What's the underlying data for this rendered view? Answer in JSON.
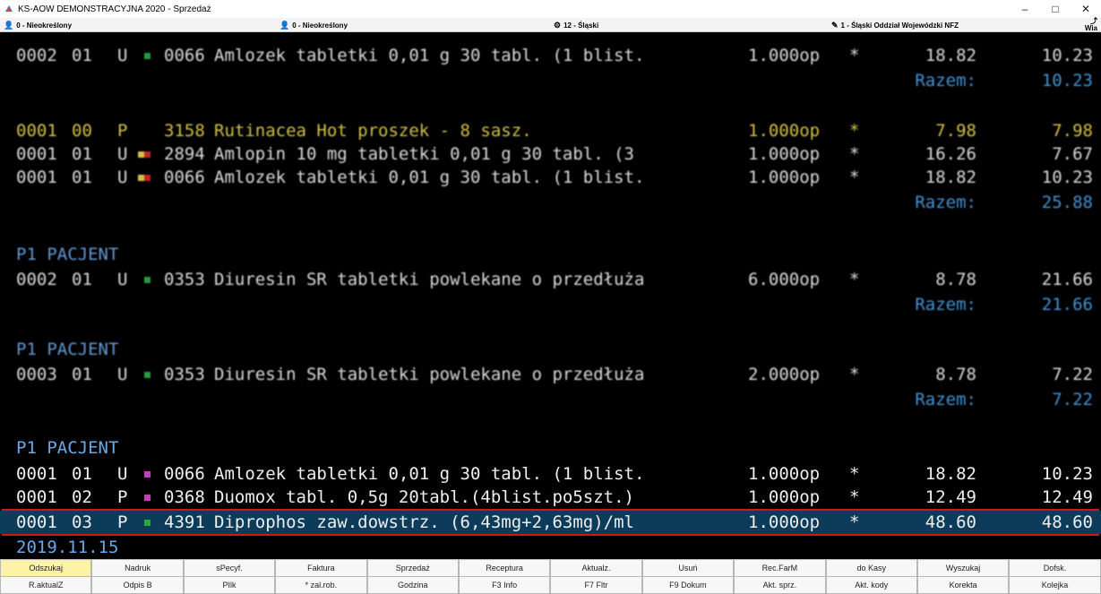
{
  "window": {
    "title": "KS-AOW DEMONSTRACYJNA 2020 - Sprzedaż",
    "minimize": "–",
    "maximize": "□",
    "close": "✕"
  },
  "status": {
    "user1": "0 - Nieokreślony",
    "user2": "0 - Nieokreślony",
    "region": "12 - Śląski",
    "nfz": "1 - Śląski Oddział Wojewódzki NFZ",
    "corner": "Wia"
  },
  "rows": [
    {
      "code": "0002",
      "sub": "01",
      "type": "U",
      "mark": "green",
      "num": "0066",
      "name": "Amlozek tabletki 0,01 g 30 tabl. (1 blist.",
      "qty": "1.000op",
      "star": "*",
      "price": "18.82",
      "value": "10.23"
    },
    {
      "code": "0001",
      "sub": "00",
      "type": "P",
      "num": "3158",
      "name": "Rutinacea Hot proszek - 8 sasz.",
      "qty": "1.000op",
      "star": "*",
      "price": "7.98",
      "value": "7.98"
    },
    {
      "code": "0001",
      "sub": "01",
      "type": "U",
      "num": "2894",
      "name": "Amlopin 10 mg tabletki 0,01 g 30 tabl. (3",
      "qty": "1.000op",
      "star": "*",
      "price": "16.26",
      "value": "7.67"
    },
    {
      "code": "0001",
      "sub": "01",
      "type": "U",
      "num": "0066",
      "name": "Amlozek tabletki 0,01 g 30 tabl. (1 blist.",
      "qty": "1.000op",
      "star": "*",
      "price": "18.82",
      "value": "10.23"
    },
    {
      "code": "0002",
      "sub": "01",
      "type": "U",
      "num": "0353",
      "name": "Diuresin SR tabletki powlekane o przedłuża",
      "qty": "6.000op",
      "star": "*",
      "price": "8.78",
      "value": "21.66"
    },
    {
      "code": "0003",
      "sub": "01",
      "type": "U",
      "num": "0353",
      "name": "Diuresin SR tabletki powlekane o przedłuża",
      "qty": "2.000op",
      "star": "*",
      "price": "8.78",
      "value": "7.22"
    },
    {
      "code": "0001",
      "sub": "01",
      "type": "U",
      "num": "0066",
      "name": "Amlozek tabletki 0,01 g 30 tabl. (1 blist.",
      "qty": "1.000op",
      "star": "*",
      "price": "18.82",
      "value": "10.23"
    },
    {
      "code": "0001",
      "sub": "02",
      "type": "P",
      "num": "0368",
      "name": "Duomox tabl. 0,5g 20tabl.(4blist.po5szt.)",
      "qty": "1.000op",
      "star": "*",
      "price": "12.49",
      "value": "12.49"
    },
    {
      "code": "0001",
      "sub": "03",
      "type": "P",
      "num": "4391",
      "name": "Diprophos zaw.dowstrz. (6,43mg+2,63mg)/ml",
      "qty": "1.000op",
      "star": "*",
      "price": "48.60",
      "value": "48.60"
    }
  ],
  "razem": {
    "label": "Razem:",
    "v1": "10.23",
    "v2": "25.88",
    "v3": "21.66",
    "v4": "7.22"
  },
  "patient": "P1 PACJENT",
  "date": "2019.11.15",
  "fkeys_row1": [
    "Odszukaj",
    "Nadruk",
    "sPecyf.",
    "Faktura",
    "Sprzedaż",
    "Receptura",
    "Aktualz.",
    "Usuń",
    "Rec.FarM",
    "do Kasy",
    "Wyszukaj",
    "Dofsk."
  ],
  "fkeys_row2": [
    "R.aktualZ",
    "Odpis B",
    "PIlk",
    "* zal.rob.",
    "Godzina",
    "F3 Info",
    "F7 Fltr",
    "F9 Dokum",
    "Akt. sprz.",
    "Akt. kody",
    "Korekta",
    "Kolejka"
  ],
  "colors": {
    "selected_bg": "#0d3c5a",
    "selection_border": "#d01818",
    "label_blue": "#4aa0e8",
    "yellow_text": "#e8d34a"
  }
}
